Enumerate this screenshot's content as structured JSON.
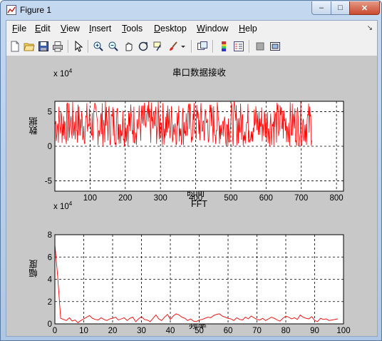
{
  "window": {
    "title": "Figure 1",
    "minimize_glyph": "–",
    "maximize_glyph": "□",
    "close_glyph": "✕"
  },
  "menubar": {
    "items": [
      {
        "first": "F",
        "rest": "ile"
      },
      {
        "first": "E",
        "rest": "dit"
      },
      {
        "first": "V",
        "rest": "iew"
      },
      {
        "first": "I",
        "rest": "nsert"
      },
      {
        "first": "T",
        "rest": "ools"
      },
      {
        "first": "D",
        "rest": "esktop"
      },
      {
        "first": "W",
        "rest": "indow"
      },
      {
        "first": "H",
        "rest": "elp"
      }
    ],
    "dock_glyph": "↘"
  },
  "toolbar": {
    "buttons": [
      "new-figure-icon",
      "open-file-icon",
      "save-icon",
      "print-icon",
      "edit-plot-arrow-icon",
      "zoom-in-icon",
      "zoom-out-icon",
      "pan-hand-icon",
      "rotate-3d-icon",
      "data-cursor-icon",
      "brush-icon",
      "brush-dropdown-icon",
      "link-plot-icon",
      "insert-colorbar-icon",
      "insert-legend-icon",
      "hide-plot-tools-icon",
      "show-plot-tools-icon"
    ]
  },
  "plot1": {
    "title": "串口数据接收",
    "xlabel": "时间",
    "ylabel": "数据",
    "exponent_base": "x 10",
    "exponent_power": "4",
    "line_color": "#ff0000"
  },
  "plot2": {
    "title": "FFT",
    "xlabel": "频率",
    "ylabel": "幅度",
    "exponent_base": "x 10",
    "exponent_power": "4",
    "line_color": "#ff0000"
  },
  "chart_data": [
    {
      "type": "line",
      "title": "串口数据接收",
      "xlabel": "时间",
      "ylabel": "数据",
      "y_exponent": "x 10^4",
      "xlim": [
        0,
        820
      ],
      "ylim": [
        -6.5,
        6.5
      ],
      "xticks": [
        100,
        200,
        300,
        400,
        500,
        600,
        700,
        800
      ],
      "yticks": [
        -5,
        0,
        5
      ],
      "grid": true,
      "series": [
        {
          "color": "#ff0000",
          "x_range": [
            1,
            730
          ],
          "y_range": [
            0,
            6.5
          ],
          "x": [],
          "y": []
        }
      ]
    },
    {
      "type": "line",
      "title": "FFT",
      "xlabel": "频率",
      "ylabel": "幅度",
      "y_exponent": "x 10^4",
      "xlim": [
        0,
        100
      ],
      "ylim": [
        0,
        8
      ],
      "xticks": [
        0,
        10,
        20,
        30,
        40,
        50,
        60,
        70,
        80,
        90,
        100
      ],
      "yticks": [
        0,
        2,
        4,
        6,
        8
      ],
      "grid": true,
      "series": [
        {
          "color": "#ff0000",
          "x": [
            0,
            1,
            2,
            3,
            4,
            5,
            6,
            7,
            8,
            9,
            10,
            11,
            12,
            13,
            14,
            15,
            16,
            17,
            18,
            19,
            20,
            21,
            22,
            23,
            24,
            25,
            26,
            27,
            28,
            29,
            30,
            31,
            32,
            33,
            34,
            35,
            36,
            37,
            38,
            39,
            40,
            41,
            42,
            43,
            44,
            45,
            46,
            47,
            48,
            49,
            50,
            51,
            52,
            53,
            54,
            55,
            56,
            57,
            58,
            59,
            60,
            61,
            62,
            63,
            64,
            65,
            66,
            67,
            68,
            69,
            70,
            71,
            72,
            73,
            74,
            75,
            76,
            77,
            78,
            79,
            80,
            81,
            82,
            83,
            84,
            85,
            86,
            87,
            88,
            89,
            90,
            91,
            92,
            93,
            94,
            95,
            96,
            97,
            98
          ],
          "y": [
            7.1,
            4.2,
            0.5,
            0.4,
            0.3,
            0.55,
            0.25,
            0.35,
            0.1,
            0.3,
            0.45,
            0.6,
            0.75,
            0.5,
            0.4,
            0.35,
            0.55,
            0.4,
            0.3,
            0.45,
            0.5,
            0.6,
            0.35,
            0.45,
            0.55,
            0.3,
            0.5,
            0.6,
            0.2,
            0.45,
            0.65,
            0.4,
            0.35,
            0.2,
            0.5,
            0.8,
            0.45,
            0.3,
            0.6,
            0.85,
            0.4,
            0.7,
            0.9,
            0.8,
            0.6,
            0.5,
            0.3,
            0.45,
            0.25,
            0.2,
            0.35,
            0.4,
            0.5,
            0.6,
            0.55,
            0.75,
            0.85,
            0.9,
            0.7,
            0.6,
            0.5,
            0.45,
            0.3,
            0.55,
            0.4,
            0.35,
            0.6,
            0.45,
            0.7,
            0.55,
            0.4,
            0.35,
            0.5,
            0.3,
            0.45,
            0.6,
            0.5,
            0.35,
            0.25,
            0.5,
            0.7,
            0.6,
            0.45,
            0.55,
            0.4,
            0.8,
            0.6,
            0.5,
            0.45,
            0.65,
            0.3,
            0.2,
            0.5,
            0.4,
            0.45,
            0.3,
            0.35,
            0.4,
            0.45
          ]
        }
      ]
    }
  ]
}
